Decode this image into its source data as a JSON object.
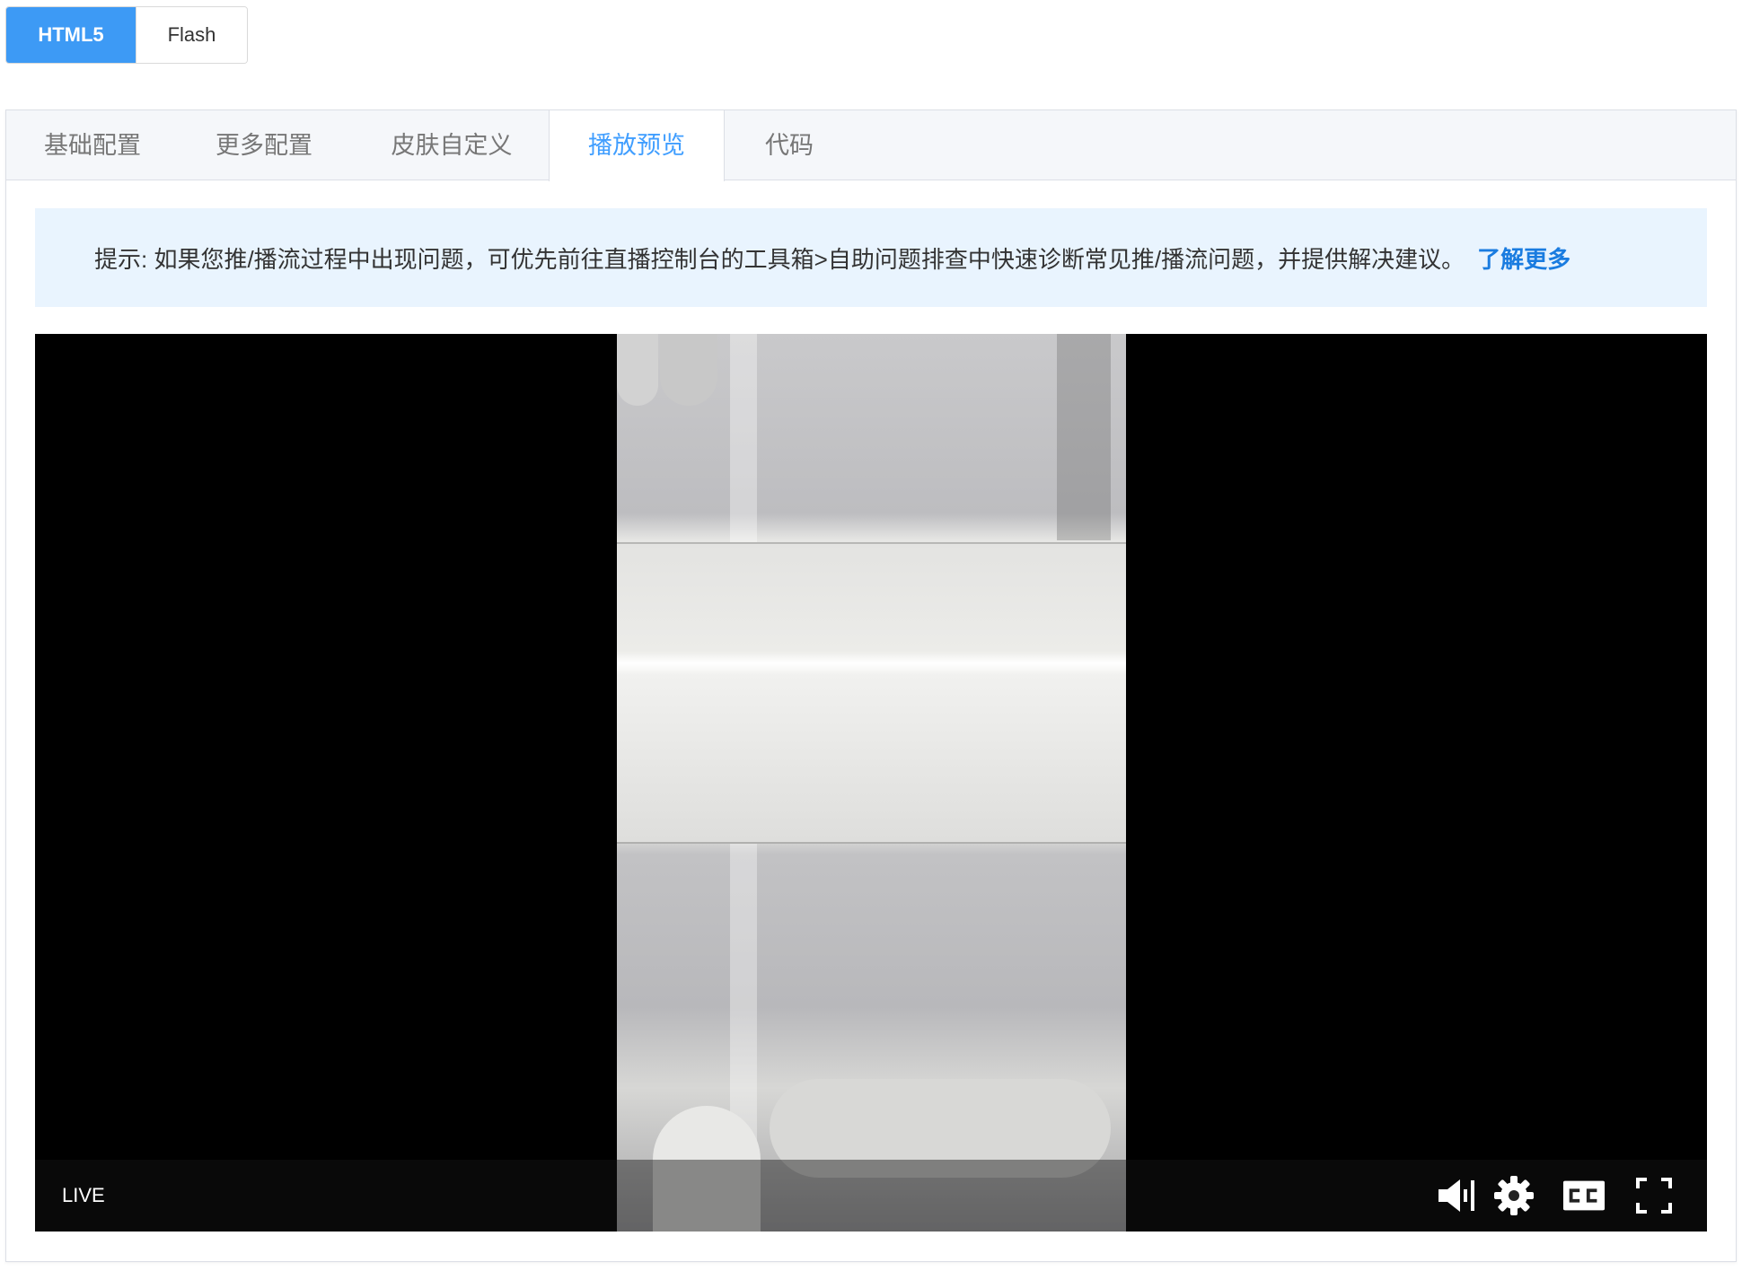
{
  "mode_toggle": {
    "html5": "HTML5",
    "flash": "Flash",
    "selected": "HTML5"
  },
  "tabs": [
    "基础配置",
    "更多配置",
    "皮肤自定义",
    "播放预览",
    "代码"
  ],
  "active_tab": "播放预览",
  "tip": {
    "text": "提示: 如果您推/播流过程中出现问题，可优先前往直播控制台的工具箱>自助问题排查中快速诊断常见推/播流问题，并提供解决建议。",
    "link": "了解更多"
  },
  "player": {
    "live_label": "LIVE",
    "controls": [
      "volume-icon",
      "settings-icon",
      "captions-icon",
      "fullscreen-icon"
    ]
  },
  "colors": {
    "accent": "#409eff",
    "toggle_active": "#3d9af5",
    "tip_bg": "#e9f4fe",
    "link": "#1a7ce0"
  }
}
